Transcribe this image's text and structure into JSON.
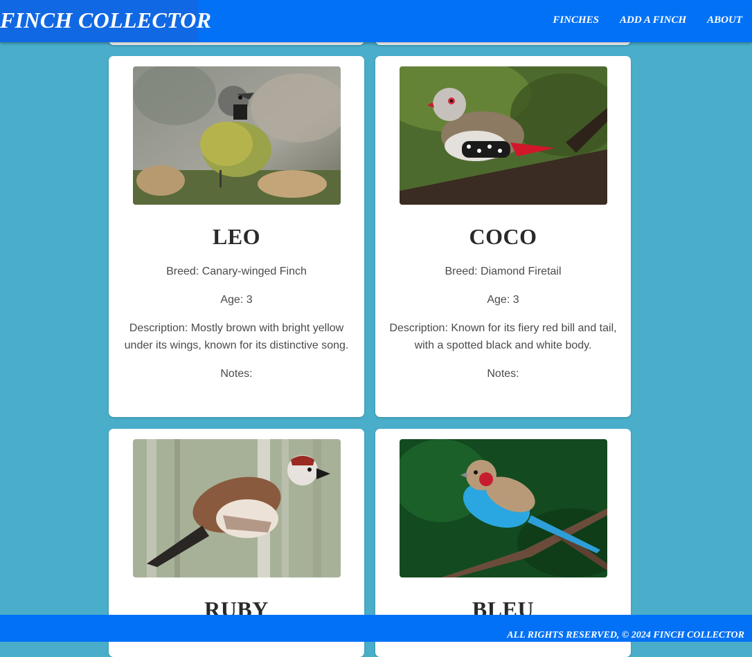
{
  "header": {
    "title": "FINCH COLLECTOR",
    "nav": [
      "FINCHES",
      "ADD A FINCH",
      "ABOUT"
    ]
  },
  "finches": [
    {
      "name": "LEO",
      "breed": "Breed: Canary-winged Finch",
      "age": "Age: 3",
      "description": "Description: Mostly brown with bright yellow under its wings, known for its distinctive song.",
      "notes": "Notes:"
    },
    {
      "name": "COCO",
      "breed": "Breed: Diamond Firetail",
      "age": "Age: 3",
      "description": "Description: Known for its fiery red bill and tail, with a spotted black and white body.",
      "notes": "Notes:"
    },
    {
      "name": "RUBY"
    },
    {
      "name": "BLEU"
    }
  ],
  "footer": {
    "text": "ALL RIGHTS RESERVED, © 2024 FINCH COLLECTOR"
  },
  "colors": {
    "background": "#4aaecb",
    "header": "#0271f6"
  }
}
